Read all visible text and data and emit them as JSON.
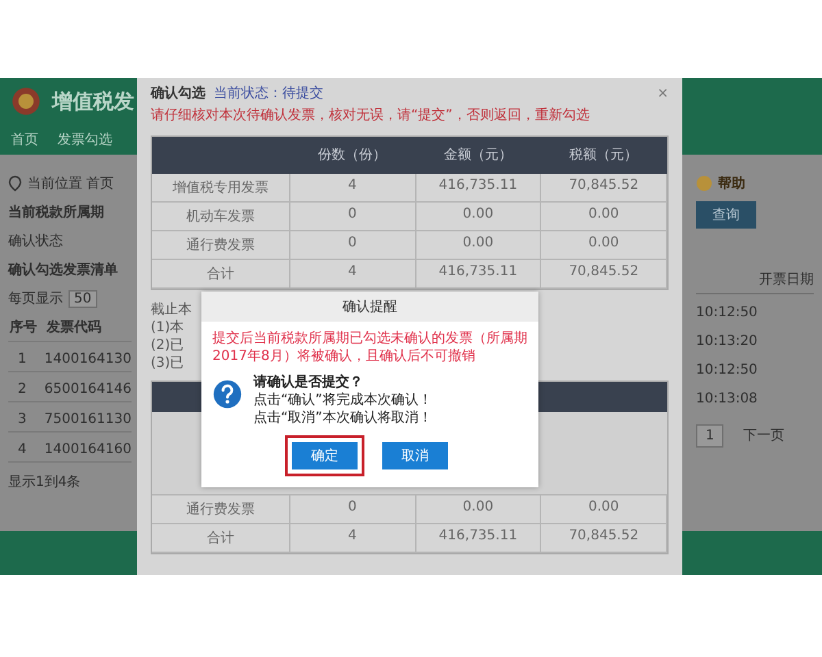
{
  "app": {
    "title": "增值税发",
    "nav": [
      "首页",
      "发票勾选"
    ],
    "location": "当前位置 首页",
    "period_label": "当前税款所属期",
    "status_label": "确认状态",
    "list_title": "确认勾选发票清单",
    "page_size_label": "每页显示",
    "page_size": "50",
    "list_columns": [
      "序号",
      "发票代码"
    ],
    "list_rows": [
      [
        "1",
        "1400164130"
      ],
      [
        "2",
        "6500164146"
      ],
      [
        "3",
        "7500161130"
      ],
      [
        "4",
        "1400164160"
      ]
    ],
    "list_footer": "显示1到4条",
    "help": "帮助",
    "action_button": "查询",
    "right_column": "开票日期",
    "right_rows": [
      "10:12:50",
      "10:13:20",
      "10:12:50",
      "10:13:08"
    ],
    "pager": [
      {
        "label": "1",
        "selected": true
      },
      {
        "label": "下一页",
        "selected": false
      }
    ]
  },
  "dialog": {
    "title": "确认勾选",
    "status": "当前状态：待提交",
    "notice": "请仔细核对本次待确认发票，核对无误，请“提交”，否则返回，重新勾选",
    "close": "×",
    "columns": [
      "",
      "份数（份）",
      "金额（元）",
      "税额（元）"
    ],
    "rows": [
      [
        "增值税专用发票",
        "4",
        "416,735.11",
        "70,845.52"
      ],
      [
        "机动车发票",
        "0",
        "0.00",
        "0.00"
      ],
      [
        "通行费发票",
        "0",
        "0.00",
        "0.00"
      ],
      [
        "合计",
        "4",
        "416,735.11",
        "70,845.52"
      ]
    ],
    "notes": [
      "截止本",
      "(1)本",
      "(2)已",
      "(3)已"
    ],
    "second_rows": [
      [
        "通行费发票",
        "0",
        "0.00",
        "0.00"
      ],
      [
        "合计",
        "4",
        "416,735.11",
        "70,845.52"
      ]
    ]
  },
  "popup": {
    "title": "确认提醒",
    "warning": "提交后当前税款所属期已勾选未确认的发票（所属期2017年8月）将被确认，且确认后不可撤销",
    "question": "请确认是否提交？",
    "lines": [
      "点击“确认”将完成本次确认！",
      "点击“取消”本次确认将取消！"
    ],
    "buttons": [
      {
        "label": "确定",
        "highlighted": true
      },
      {
        "label": "取消",
        "highlighted": false
      }
    ]
  }
}
